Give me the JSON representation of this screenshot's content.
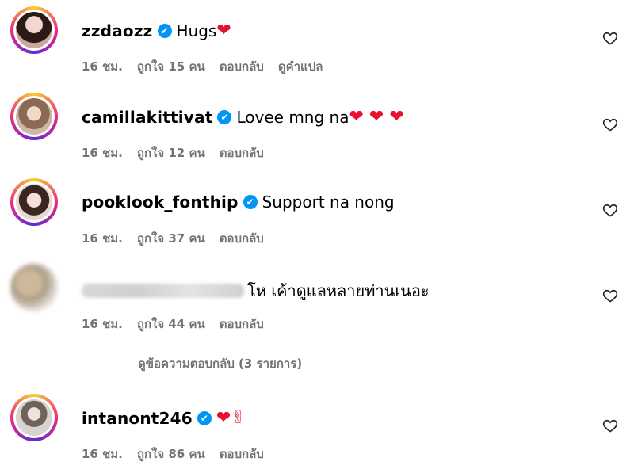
{
  "comments": [
    {
      "username": "zzdaozz",
      "verified": true,
      "text": "Hugs",
      "emoji": "❤",
      "time": "16 ชม.",
      "likes": "ถูกใจ 15 คน",
      "reply": "ตอบกลับ",
      "translate": "ดูคำแปล"
    },
    {
      "username": "camillakittivat",
      "verified": true,
      "text": "Lovee mng na",
      "emoji": "❤ ❤ ❤",
      "time": "16 ชม.",
      "likes": "ถูกใจ 12 คน",
      "reply": "ตอบกลับ"
    },
    {
      "username": "pooklook_fonthip",
      "verified": true,
      "text": "Support na nong",
      "time": "16 ชม.",
      "likes": "ถูกใจ 37 คน",
      "reply": "ตอบกลับ"
    },
    {
      "text": "โห เค้าดูแลหลายท่านเนอะ",
      "time": "16 ชม.",
      "likes": "ถูกใจ 44 คน",
      "reply": "ตอบกลับ"
    },
    {
      "username": "intanont246",
      "verified": true,
      "emoji": "❤✌",
      "time": "16 ชม.",
      "likes": "ถูกใจ 86 คน",
      "reply": "ตอบกลับ"
    }
  ],
  "view_replies": "ดูข้อความตอบกลับ (3 รายการ)",
  "icons": {
    "verified": "✔",
    "like": "heart-outline-icon"
  },
  "colors": {
    "meta": "#737373",
    "verified": "#0095f6",
    "heart": "#e8112d"
  }
}
